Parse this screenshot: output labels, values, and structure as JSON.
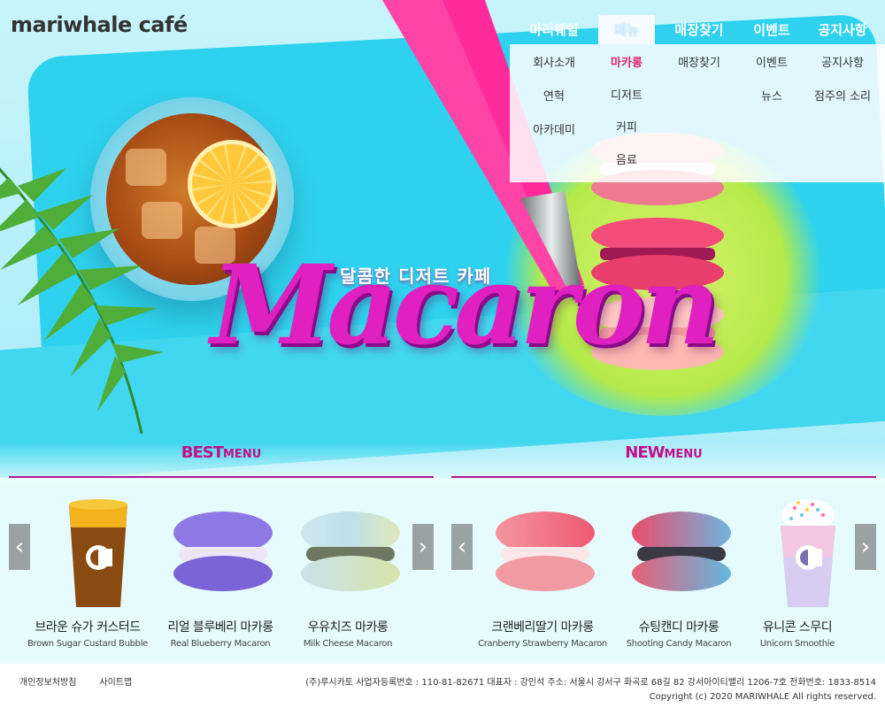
{
  "header": {
    "logo": "mariwhale café",
    "nav": [
      {
        "label": "마리웨일",
        "active": false
      },
      {
        "label": "메뉴",
        "active": true
      },
      {
        "label": "매장찾기",
        "active": false
      },
      {
        "label": "이벤트",
        "active": false
      },
      {
        "label": "공지사항",
        "active": false
      }
    ],
    "submenu": [
      [
        "회사소개",
        "연혁",
        "아카데미"
      ],
      [
        "마카롱",
        "디저트",
        "커피",
        "음료"
      ],
      [
        "매장찾기"
      ],
      [
        "이벤트",
        "뉴스"
      ],
      [
        "공지사항",
        "점주의 소리"
      ]
    ],
    "submenu_active": "마카롱"
  },
  "hero": {
    "tagline": "달콤한 디저트 카페",
    "title": "Macaron"
  },
  "best": {
    "title_big": "BEST",
    "title_small": "MENU",
    "items": [
      {
        "kr": "브라운 슈가 커스터드",
        "en": "Brown Sugar Custard Bubble"
      },
      {
        "kr": "리얼 블루베리 마카롱",
        "en": "Real Blueberry Macaron"
      },
      {
        "kr": "우유치즈 마카롱",
        "en": "Milk Cheese Macaron"
      }
    ]
  },
  "new": {
    "title_big": "NEW",
    "title_small": "MENU",
    "items": [
      {
        "kr": "크랜베리딸기 마카롱",
        "en": "Cranberry Strawberry Macaron"
      },
      {
        "kr": "슈팅캔디 마카롱",
        "en": "Shooting Candy Macaron"
      },
      {
        "kr": "유니콘 스무디",
        "en": "Unicorn Smoothie"
      }
    ]
  },
  "arrows": {
    "prev": "‹",
    "next": "›"
  },
  "footer": {
    "links": [
      "개인정보처방침",
      "사이트맵"
    ],
    "info": "(주)루시카토 사업자등록번호 : 110-81-82671 대표자 : 강인석 주소: 서울시 강서구 화곡로 68길 82 강서아이티밸리 1206-7호 전화번호: 1833-8514",
    "copyright": "Copyright (c) 2020 MARIWHALE All rights reserved."
  },
  "colors": {
    "accent": "#c0118c",
    "active_sub": "#e0226c",
    "hero_cyan": "#2ed2ee",
    "hero_pink": "#ff2b9a"
  }
}
